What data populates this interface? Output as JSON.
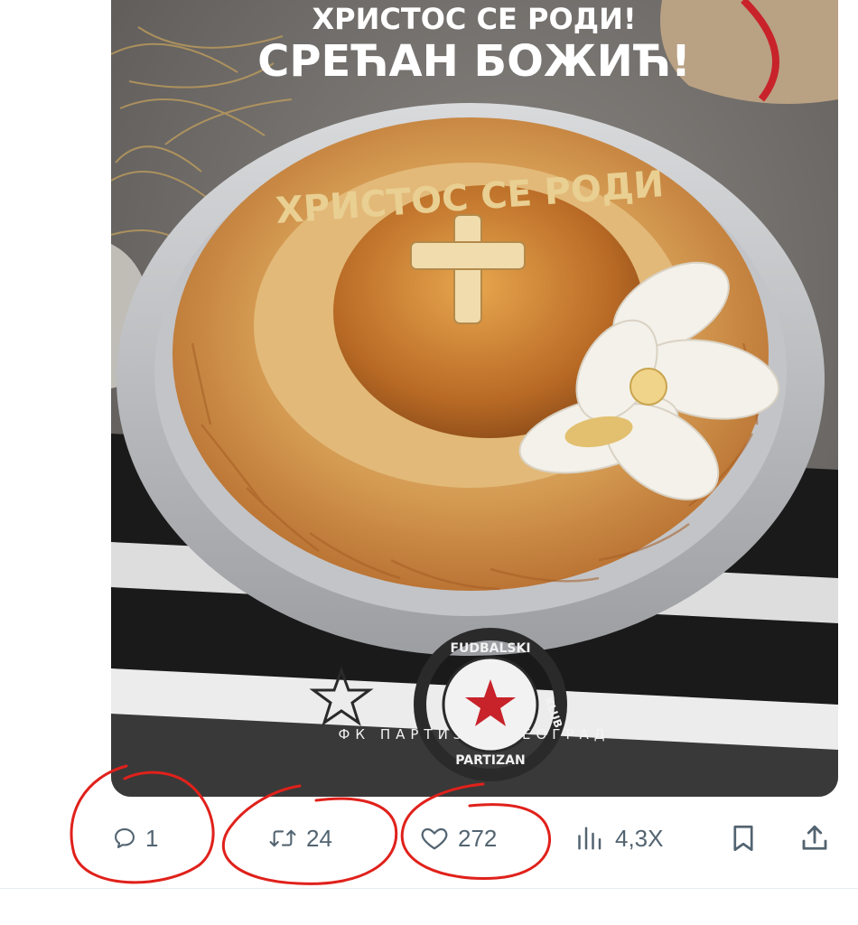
{
  "post": {
    "image": {
      "headline_line1": "ХРИСТОС СЕ РОДИ!",
      "headline_line2": "СРЕЋАН БОЖИЋ!",
      "bread_inscription": "ХРИСТОС СЕ РОДИ",
      "club_name": "ФК ПАРТИЗАН БЕОГРАД",
      "crest_ring_top": "FUDBALSKI",
      "crest_ring_bottom": "PARTIZAN",
      "crest_ring_side": "KLUB"
    }
  },
  "actions": {
    "reply": {
      "count": "1",
      "icon": "speech-bubble-icon"
    },
    "retweet": {
      "count": "24",
      "icon": "retweet-arrows-icon"
    },
    "like": {
      "count": "272",
      "icon": "heart-icon"
    },
    "views": {
      "count": "4,3Х",
      "icon": "bar-chart-icon"
    },
    "bookmark": {
      "icon": "bookmark-icon"
    },
    "share": {
      "icon": "share-upload-icon"
    }
  },
  "annotation_color": "#e0211b",
  "icon_color": "#536471"
}
